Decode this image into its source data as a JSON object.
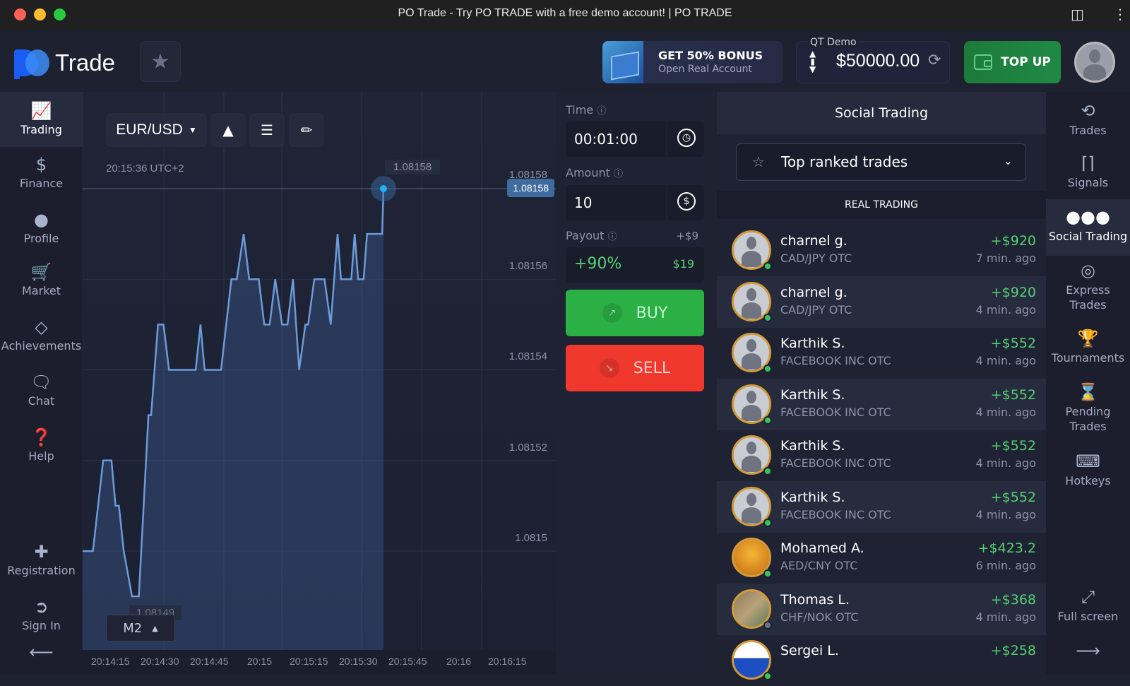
{
  "window": {
    "title": "PO Trade - Try PO TRADE with a free demo account! | PO TRADE"
  },
  "header": {
    "logo_text": "Trade",
    "bonus_title": "GET 50% BONUS",
    "bonus_subtitle": "Open Real Account",
    "account_label": "QT Demo",
    "balance": "$50000.00",
    "topup_label": "TOP UP"
  },
  "left_nav": [
    {
      "label": "Trading",
      "icon": "chart-line-icon",
      "active": true
    },
    {
      "label": "Finance",
      "icon": "dollar-icon"
    },
    {
      "label": "Profile",
      "icon": "user-icon"
    },
    {
      "label": "Market",
      "icon": "cart-icon"
    },
    {
      "label": "Achievements",
      "icon": "diamond-icon"
    },
    {
      "label": "Chat",
      "icon": "chat-icon"
    },
    {
      "label": "Help",
      "icon": "help-icon"
    },
    {
      "label": "Registration",
      "icon": "user-plus-icon"
    },
    {
      "label": "Sign In",
      "icon": "sign-in-icon"
    }
  ],
  "chart_toolbar": {
    "pair": "EUR/USD",
    "timestamp": "20:15:36 UTC+2",
    "timeframe": "M2"
  },
  "chart_data": {
    "type": "area",
    "title": "EUR/USD",
    "current_price": "1.08158",
    "point_label": "1.08158",
    "top_label": "1.08158",
    "low_label": "1.08149",
    "yticks": [
      "1.08158",
      "1.08156",
      "1.08154",
      "1.08152",
      "1.0815"
    ],
    "ylim": [
      1.08149,
      1.08158
    ],
    "xticks": [
      "20:14:15",
      "20:14:30",
      "20:14:45",
      "20:15",
      "20:15:15",
      "20:15:30",
      "20:15:45",
      "20:16",
      "20:16:15"
    ],
    "series": [
      {
        "name": "EUR/USD",
        "points": [
          [
            0,
            1.0815
          ],
          [
            1.5,
            1.0815
          ],
          [
            3,
            1.08152
          ],
          [
            4.2,
            1.08152
          ],
          [
            4.8,
            1.08151
          ],
          [
            5.3,
            1.08151
          ],
          [
            6,
            1.0815
          ],
          [
            7.2,
            1.08149
          ],
          [
            8.2,
            1.08149
          ],
          [
            9.6,
            1.08153
          ],
          [
            10,
            1.08153
          ],
          [
            11,
            1.08155
          ],
          [
            11.8,
            1.08155
          ],
          [
            12.6,
            1.08154
          ],
          [
            16.5,
            1.08154
          ],
          [
            17.2,
            1.08155
          ],
          [
            17.8,
            1.08154
          ],
          [
            20.2,
            1.08154
          ],
          [
            21.7,
            1.08156
          ],
          [
            22.5,
            1.08156
          ],
          [
            23.5,
            1.08157
          ],
          [
            24.3,
            1.08156
          ],
          [
            25.7,
            1.08156
          ],
          [
            26.5,
            1.08155
          ],
          [
            27.3,
            1.08155
          ],
          [
            28.1,
            1.08156
          ],
          [
            29.1,
            1.08155
          ],
          [
            29.9,
            1.08155
          ],
          [
            30.7,
            1.08156
          ],
          [
            31.6,
            1.08154
          ],
          [
            32.5,
            1.08155
          ],
          [
            32.9,
            1.08155
          ],
          [
            33.8,
            1.08156
          ],
          [
            35.3,
            1.08156
          ],
          [
            36.2,
            1.08155
          ],
          [
            37.2,
            1.08157
          ],
          [
            37.7,
            1.08156
          ],
          [
            39.2,
            1.08156
          ],
          [
            39.7,
            1.08157
          ],
          [
            40.2,
            1.08156
          ],
          [
            41,
            1.08156
          ],
          [
            41.5,
            1.08157
          ],
          [
            43.7,
            1.08157
          ],
          [
            43.9,
            1.08158
          ]
        ]
      }
    ],
    "x_unit": "seconds from 20:14:00 (approx)"
  },
  "trade_panel": {
    "time_label": "Time",
    "time_value": "00:01:00",
    "amount_label": "Amount",
    "amount_value": "10",
    "payout_label": "Payout",
    "payout_extra": "+$9",
    "payout_percent": "+90%",
    "payout_amount": "$19",
    "buy_label": "BUY",
    "sell_label": "SELL"
  },
  "social": {
    "title": "Social Trading",
    "filter": "Top ranked trades",
    "section": "REAL TRADING",
    "trades": [
      {
        "name": "charnel g.",
        "pair": "CAD/JPY OTC",
        "profit": "+$920",
        "ago": "7 min. ago",
        "online": true,
        "avatar": "default"
      },
      {
        "name": "charnel g.",
        "pair": "CAD/JPY OTC",
        "profit": "+$920",
        "ago": "4 min. ago",
        "online": true,
        "avatar": "default"
      },
      {
        "name": "Karthik S.",
        "pair": "FACEBOOK INC OTC",
        "profit": "+$552",
        "ago": "4 min. ago",
        "online": true,
        "avatar": "default"
      },
      {
        "name": "Karthik S.",
        "pair": "FACEBOOK INC OTC",
        "profit": "+$552",
        "ago": "4 min. ago",
        "online": true,
        "avatar": "default"
      },
      {
        "name": "Karthik S.",
        "pair": "FACEBOOK INC OTC",
        "profit": "+$552",
        "ago": "4 min. ago",
        "online": true,
        "avatar": "default"
      },
      {
        "name": "Karthik S.",
        "pair": "FACEBOOK INC OTC",
        "profit": "+$552",
        "ago": "4 min. ago",
        "online": true,
        "avatar": "default"
      },
      {
        "name": "Mohamed A.",
        "pair": "AED/CNY OTC",
        "profit": "+$423.2",
        "ago": "6 min. ago",
        "online": true,
        "avatar": "freedom"
      },
      {
        "name": "Thomas L.",
        "pair": "CHF/NOK OTC",
        "profit": "+$368",
        "ago": "4 min. ago",
        "online": false,
        "avatar": "photo"
      },
      {
        "name": "Sergei L.",
        "pair": "",
        "profit": "+$258",
        "ago": "",
        "online": true,
        "avatar": "flag-ru"
      }
    ]
  },
  "right_nav": [
    {
      "label": "Trades",
      "icon": "history-icon"
    },
    {
      "label": "Signals",
      "icon": "antenna-icon"
    },
    {
      "label": "Social Trading",
      "icon": "users-icon",
      "active": true
    },
    {
      "label": "Express Trades",
      "icon": "target-icon"
    },
    {
      "label": "Tournaments",
      "icon": "trophy-icon"
    },
    {
      "label": "Pending Trades",
      "icon": "hourglass-icon"
    },
    {
      "label": "Hotkeys",
      "icon": "keyboard-icon"
    },
    {
      "label": "Full screen",
      "icon": "fullscreen-icon"
    }
  ],
  "colors": {
    "buy": "#2bb046",
    "sell": "#f0382c",
    "profit": "#55d173",
    "accent": "#3b8cf6",
    "topup": "#1f8a45"
  }
}
